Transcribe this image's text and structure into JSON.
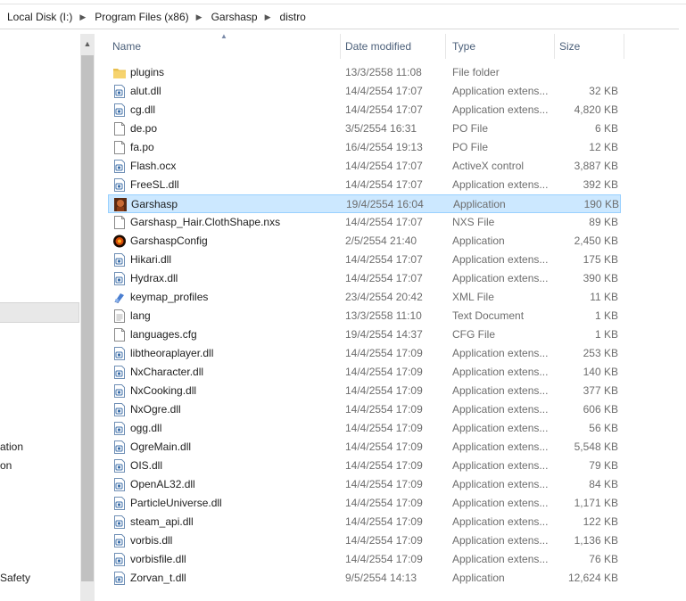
{
  "breadcrumb": [
    "Local Disk (I:)",
    "Program Files (x86)",
    "Garshasp",
    "distro"
  ],
  "nav": {
    "scroll_up_icon": "chevron-up-icon",
    "items": [
      "ation",
      "on",
      "Safety"
    ]
  },
  "columns": {
    "name": "Name",
    "date": "Date modified",
    "type": "Type",
    "size": "Size"
  },
  "files": [
    {
      "name": "plugins",
      "date": "13/3/2558 11:08",
      "type": "File folder",
      "size": "",
      "icon": "folder-icon"
    },
    {
      "name": "alut.dll",
      "date": "14/4/2554 17:07",
      "type": "Application extens...",
      "size": "32 KB",
      "icon": "dll-file-icon"
    },
    {
      "name": "cg.dll",
      "date": "14/4/2554 17:07",
      "type": "Application extens...",
      "size": "4,820 KB",
      "icon": "dll-file-icon"
    },
    {
      "name": "de.po",
      "date": "3/5/2554 16:31",
      "type": "PO File",
      "size": "6 KB",
      "icon": "blank-file-icon"
    },
    {
      "name": "fa.po",
      "date": "16/4/2554 19:13",
      "type": "PO File",
      "size": "12 KB",
      "icon": "blank-file-icon"
    },
    {
      "name": "Flash.ocx",
      "date": "14/4/2554 17:07",
      "type": "ActiveX control",
      "size": "3,887 KB",
      "icon": "dll-file-icon"
    },
    {
      "name": "FreeSL.dll",
      "date": "14/4/2554 17:07",
      "type": "Application extens...",
      "size": "392 KB",
      "icon": "dll-file-icon"
    },
    {
      "name": "Garshasp",
      "date": "19/4/2554 16:04",
      "type": "Application",
      "size": "190 KB",
      "icon": "garshasp-app-icon",
      "selected": true
    },
    {
      "name": "Garshasp_Hair.ClothShape.nxs",
      "date": "14/4/2554 17:07",
      "type": "NXS File",
      "size": "89 KB",
      "icon": "blank-file-icon"
    },
    {
      "name": "GarshaspConfig",
      "date": "2/5/2554 21:40",
      "type": "Application",
      "size": "2,450 KB",
      "icon": "config-app-icon"
    },
    {
      "name": "Hikari.dll",
      "date": "14/4/2554 17:07",
      "type": "Application extens...",
      "size": "175 KB",
      "icon": "dll-file-icon"
    },
    {
      "name": "Hydrax.dll",
      "date": "14/4/2554 17:07",
      "type": "Application extens...",
      "size": "390 KB",
      "icon": "dll-file-icon"
    },
    {
      "name": "keymap_profiles",
      "date": "23/4/2554 20:42",
      "type": "XML File",
      "size": "11 KB",
      "icon": "xml-file-icon"
    },
    {
      "name": "lang",
      "date": "13/3/2558 11:10",
      "type": "Text Document",
      "size": "1 KB",
      "icon": "text-file-icon"
    },
    {
      "name": "languages.cfg",
      "date": "19/4/2554 14:37",
      "type": "CFG File",
      "size": "1 KB",
      "icon": "blank-file-icon"
    },
    {
      "name": "libtheoraplayer.dll",
      "date": "14/4/2554 17:09",
      "type": "Application extens...",
      "size": "253 KB",
      "icon": "dll-file-icon"
    },
    {
      "name": "NxCharacter.dll",
      "date": "14/4/2554 17:09",
      "type": "Application extens...",
      "size": "140 KB",
      "icon": "dll-file-icon"
    },
    {
      "name": "NxCooking.dll",
      "date": "14/4/2554 17:09",
      "type": "Application extens...",
      "size": "377 KB",
      "icon": "dll-file-icon"
    },
    {
      "name": "NxOgre.dll",
      "date": "14/4/2554 17:09",
      "type": "Application extens...",
      "size": "606 KB",
      "icon": "dll-file-icon"
    },
    {
      "name": "ogg.dll",
      "date": "14/4/2554 17:09",
      "type": "Application extens...",
      "size": "56 KB",
      "icon": "dll-file-icon"
    },
    {
      "name": "OgreMain.dll",
      "date": "14/4/2554 17:09",
      "type": "Application extens...",
      "size": "5,548 KB",
      "icon": "dll-file-icon"
    },
    {
      "name": "OIS.dll",
      "date": "14/4/2554 17:09",
      "type": "Application extens...",
      "size": "79 KB",
      "icon": "dll-file-icon"
    },
    {
      "name": "OpenAL32.dll",
      "date": "14/4/2554 17:09",
      "type": "Application extens...",
      "size": "84 KB",
      "icon": "dll-file-icon"
    },
    {
      "name": "ParticleUniverse.dll",
      "date": "14/4/2554 17:09",
      "type": "Application extens...",
      "size": "1,171 KB",
      "icon": "dll-file-icon"
    },
    {
      "name": "steam_api.dll",
      "date": "14/4/2554 17:09",
      "type": "Application extens...",
      "size": "122 KB",
      "icon": "dll-file-icon"
    },
    {
      "name": "vorbis.dll",
      "date": "14/4/2554 17:09",
      "type": "Application extens...",
      "size": "1,136 KB",
      "icon": "dll-file-icon"
    },
    {
      "name": "vorbisfile.dll",
      "date": "14/4/2554 17:09",
      "type": "Application extens...",
      "size": "76 KB",
      "icon": "dll-file-icon"
    },
    {
      "name": "Zorvan_t.dll",
      "date": "9/5/2554 14:13",
      "type": "Application",
      "size": "12,624 KB",
      "icon": "dll-file-icon"
    }
  ],
  "colors": {
    "selection_fill": "#cce8ff",
    "selection_border": "#99d1ff",
    "header_text": "#4c607a",
    "detail_text": "#6d6d6d"
  }
}
